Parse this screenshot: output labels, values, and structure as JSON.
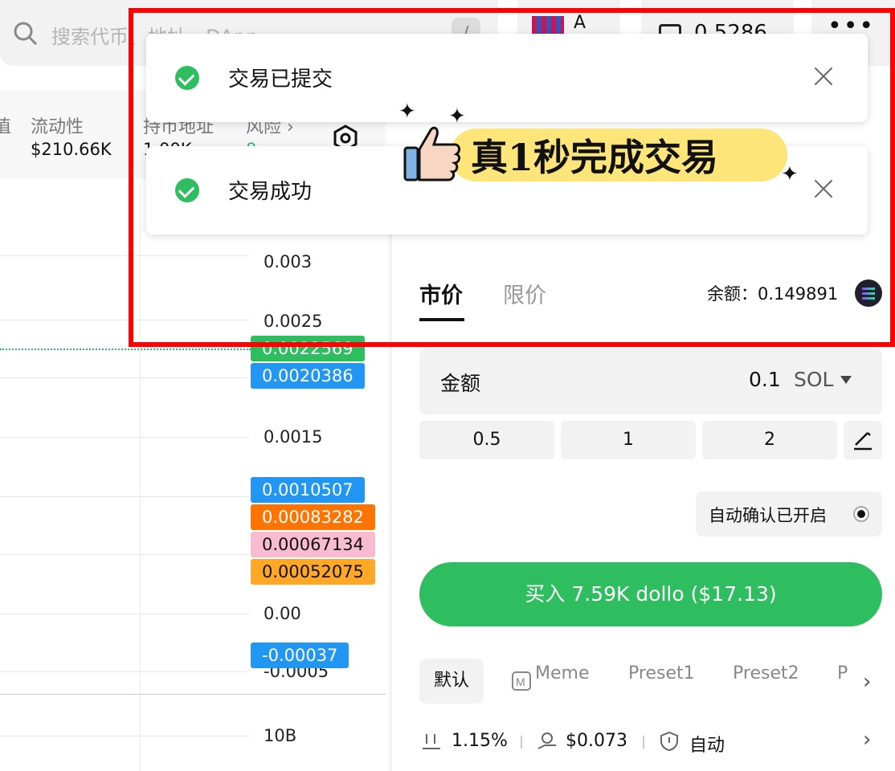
{
  "search": {
    "placeholder": "搜索代币、地址、DApp",
    "shortcut": "/"
  },
  "wallet": {
    "name": "A"
  },
  "balance_button": {
    "value": "0.5286"
  },
  "stats": [
    {
      "label": "值",
      "value": ""
    },
    {
      "label": "流动性",
      "value": "$210.66K"
    },
    {
      "label": "持币地址",
      "value": "1.00K"
    },
    {
      "label": "风险 ›",
      "value": "0"
    }
  ],
  "chart": {
    "ticks": [
      "0.003",
      "0.0025",
      "0.0015",
      "0.00",
      "-0.0005",
      "10B"
    ],
    "price_tags": [
      {
        "value": "0.0022569",
        "color": "#2ebd5f"
      },
      {
        "value": "0.0020386",
        "color": "#2196f3"
      },
      {
        "value": "0.0010507",
        "color": "#2196f3"
      },
      {
        "value": "0.00083282",
        "color": "#ff7300"
      },
      {
        "value": "0.00067134",
        "color": "#f8bbd0"
      },
      {
        "value": "0.00052075",
        "color": "#ffa726"
      },
      {
        "value": "-0.00037",
        "color": "#2196f3"
      }
    ]
  },
  "trade": {
    "tabs": [
      "市价",
      "限价"
    ],
    "balance_label": "余额：0.149891",
    "amount_label": "金额",
    "amount_value": "0.1",
    "amount_unit": "SOL",
    "presets": [
      "0.5",
      "1",
      "2"
    ],
    "auto_confirm": "自动确认已开启",
    "buy_label": "买入 7.59K dollo ($17.13)",
    "modes": [
      "默认",
      "Meme",
      "Preset1",
      "Preset2",
      "P"
    ],
    "footer": {
      "slippage": "1.15%",
      "fee": "$0.073",
      "mev": "自动"
    }
  },
  "toasts": [
    {
      "text": "交易已提交"
    },
    {
      "text": "交易成功"
    }
  ],
  "sticker": {
    "text": "真1秒完成交易"
  }
}
